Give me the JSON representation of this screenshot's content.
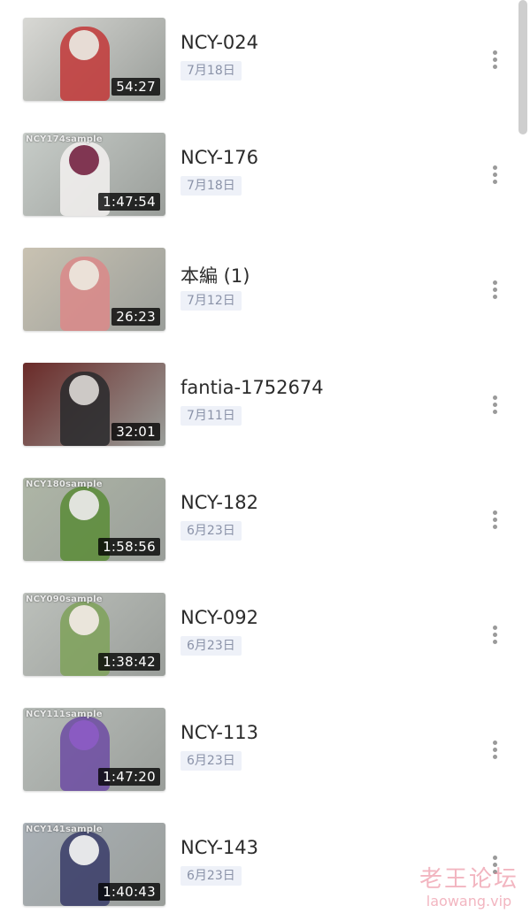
{
  "items": [
    {
      "title": "NCY-024",
      "date": "7月18日",
      "duration": "54:27",
      "caption": "",
      "thumb_bg": "#d8d8d4",
      "thumb_figure": "#c23b3b",
      "thumb_head": "#e9e4dc"
    },
    {
      "title": "NCY-176",
      "date": "7月18日",
      "duration": "1:47:54",
      "caption": "NCY174sample",
      "thumb_bg": "#c7ccc8",
      "thumb_figure": "#f1efee",
      "thumb_head": "#7a2c4a"
    },
    {
      "title": "本編 (1)",
      "date": "7月12日",
      "duration": "26:23",
      "caption": "",
      "thumb_bg": "#c9c2b2",
      "thumb_figure": "#d98a8a",
      "thumb_head": "#ece6dc"
    },
    {
      "title": "fantia-1752674",
      "date": "7月11日",
      "duration": "32:01",
      "caption": "",
      "thumb_bg": "#6a2a28",
      "thumb_figure": "#2b2b2e",
      "thumb_head": "#d6d2cf"
    },
    {
      "title": "NCY-182",
      "date": "6月23日",
      "duration": "1:58:56",
      "caption": "NCY180sample",
      "thumb_bg": "#aeb6a6",
      "thumb_figure": "#5c8c3a",
      "thumb_head": "#e8e8e6"
    },
    {
      "title": "NCY-092",
      "date": "6月23日",
      "duration": "1:38:42",
      "caption": "NCY090sample",
      "thumb_bg": "#bcc0bb",
      "thumb_figure": "#7fa25c",
      "thumb_head": "#efe9e2"
    },
    {
      "title": "NCY-113",
      "date": "6月23日",
      "duration": "1:47:20",
      "caption": "NCY111sample",
      "thumb_bg": "#b8bdb9",
      "thumb_figure": "#6e4ea3",
      "thumb_head": "#8b5cc4"
    },
    {
      "title": "NCY-143",
      "date": "6月23日",
      "duration": "1:40:43",
      "caption": "NCY141sample",
      "thumb_bg": "#a9b0b6",
      "thumb_figure": "#3b3f6a",
      "thumb_head": "#efefef"
    }
  ],
  "more_icon": "vertical-ellipsis-icon",
  "watermark": {
    "cn": "老王论坛",
    "en": "laowang.vip",
    "color": "#e8788c"
  }
}
